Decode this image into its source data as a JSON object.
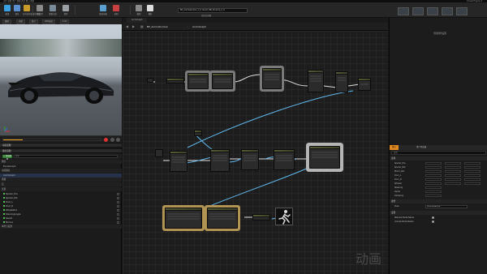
{
  "menu": "文件  编辑  资产  视图  调试  窗口  帮助",
  "brand": "Unreal Engine 4",
  "toolbar": {
    "buttons": [
      {
        "label": "编译",
        "color": "#3aa0e0"
      },
      {
        "label": "保存",
        "color": "#5a8fd0"
      },
      {
        "label": "在内容浏览器中查找",
        "color": "#c89a2a"
      },
      {
        "label": "类设置",
        "color": "#8a8a8a"
      },
      {
        "label": "类默认值",
        "color": "#7a8a9a"
      },
      {
        "label": "搜索",
        "color": "#9aa0a6"
      },
      {
        "label": "预览动画",
        "color": "#5aa0d0"
      },
      {
        "label": "录制",
        "color": "#c84040"
      },
      {
        "label": "模拟",
        "color": "#8a8a8a"
      },
      {
        "label": "播放",
        "color": "#dddddd"
      }
    ],
    "debug_filter": "BP_AnimationCar_C_0 (Anim) BP_Porsche_C_0",
    "debug_label": "调试过滤器"
  },
  "left": {
    "viewport_tabs": [
      "透视",
      "光照",
      "显示",
      "LOD自动",
      "1.0x"
    ],
    "anim_preview_header": "动画蓝图",
    "my_blueprint_header": "我的蓝图",
    "add_button": "+ 添加新项",
    "search_placeholder": "搜索",
    "items": [
      {
        "label": "图表",
        "kind": "section"
      },
      {
        "label": "EventGraph",
        "kind": "item"
      },
      {
        "label": "动画图表",
        "kind": "section"
      },
      {
        "label": "AnimGraph",
        "kind": "selected"
      },
      {
        "label": "函数",
        "kind": "section"
      },
      {
        "label": "宏",
        "kind": "section"
      },
      {
        "label": "变量",
        "kind": "section"
      },
      {
        "label": "Spoiler_Pos",
        "kind": "var"
      },
      {
        "label": "Spoiler_Rot",
        "kind": "var"
      },
      {
        "label": "Door_L",
        "kind": "var"
      },
      {
        "label": "Door_R",
        "kind": "var"
      },
      {
        "label": "WheelsRot",
        "kind": "var"
      },
      {
        "label": "SteeringAngle",
        "kind": "var"
      },
      {
        "label": "Speed",
        "kind": "var"
      },
      {
        "label": "Mirrors",
        "kind": "var"
      },
      {
        "label": "事件分发器",
        "kind": "section"
      }
    ]
  },
  "graph": {
    "tab": "AnimGraph",
    "crumb_bp": "BP_AnimationCar",
    "crumb_graph": "AnimGraph",
    "watermark": "动画"
  },
  "right": {
    "empty_message": "预览场景设置",
    "tabs": [
      "细节",
      "资产浏览器"
    ],
    "search_placeholder": "搜索",
    "categories": [
      "变换",
      "姿势",
      "设置"
    ],
    "rows": [
      "Spoiler_Pos",
      "Spoiler_Rot",
      "Mirror_Rot",
      "Door_L",
      "Door_R",
      "Wheels",
      "Steering",
      "Alpha",
      "Damping"
    ],
    "pose_prop_label": "Pose",
    "pose_prop_value": "PorscheVehicle",
    "settings": [
      "Resolve Node Name",
      "Include Node Name"
    ]
  }
}
